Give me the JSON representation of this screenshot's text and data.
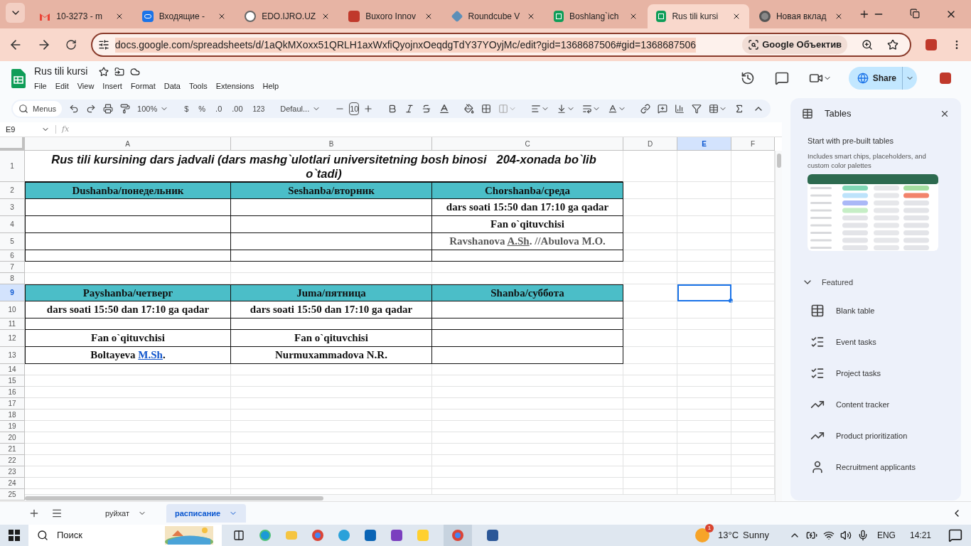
{
  "browser": {
    "tabs": [
      {
        "title": "10-3273 - m",
        "kind": "gmail",
        "selected": false
      },
      {
        "title": "Входящие -",
        "kind": "mail",
        "selected": false
      },
      {
        "title": "EDO.IJRO.UZ",
        "kind": "edo",
        "selected": false
      },
      {
        "title": "Buxoro Innov",
        "kind": "buxoro",
        "selected": false
      },
      {
        "title": "Roundcube V",
        "kind": "roundcube",
        "selected": false
      },
      {
        "title": "Boshlang`ich",
        "kind": "sheets",
        "selected": false
      },
      {
        "title": "Rus tili kursi",
        "kind": "sheets",
        "selected": true
      },
      {
        "title": "Новая вклад",
        "kind": "chrome",
        "selected": false
      }
    ],
    "url": "docs.google.com/spreadsheets/d/1aQkMXoxx51QRLH1axWxfiQyojnxOeqdgTdY37YOyjMc/edit?gid=1368687506#gid=1368687506",
    "lens_button": "Google Объектив"
  },
  "doc": {
    "title": "Rus tili kursi",
    "menu": [
      "File",
      "Edit",
      "View",
      "Insert",
      "Format",
      "Data",
      "Tools",
      "Extensions",
      "Help"
    ],
    "share": "Share"
  },
  "toolbar": {
    "search": "Menus",
    "zoom": "100%",
    "currency": "$",
    "percent": "%",
    "decrease_decimal": ".0",
    "increase_decimal": ".00",
    "number_format": "123",
    "font": "Defaul...",
    "font_size": "10"
  },
  "formula_bar": {
    "cell_ref": "E9",
    "fx": "fx"
  },
  "columns": [
    {
      "label": "A",
      "selected": false
    },
    {
      "label": "B",
      "selected": false
    },
    {
      "label": "C",
      "selected": false
    },
    {
      "label": "D",
      "selected": false
    },
    {
      "label": "E",
      "selected": true
    },
    {
      "label": "F",
      "selected": false
    }
  ],
  "rows": [
    {
      "number": "1",
      "kind": "title",
      "selected": false,
      "text": "Rus tili kursining dars jadvali (dars mashg`ulotlari universitetning bosh binosi   204-xonada bo`lib o`tadi)"
    },
    {
      "number": "2",
      "kind": "header",
      "selected": false,
      "cells": [
        {
          "text": "Dushanba/понедельник"
        },
        {
          "text": "Seshanba/вторник"
        },
        {
          "text": "Chorshanba/среда"
        }
      ]
    },
    {
      "number": "3",
      "kind": "table",
      "selected": false,
      "cells": [
        null,
        null,
        {
          "text": "dars soati 15:50 dan 17:10 ga qadar"
        }
      ]
    },
    {
      "number": "4",
      "kind": "table",
      "selected": false,
      "cells": [
        null,
        null,
        {
          "text": "Fan o`qituvchisi"
        }
      ]
    },
    {
      "number": "5",
      "kind": "table",
      "selected": false,
      "cells": [
        null,
        null,
        {
          "kind": "muted",
          "parts": [
            {
              "text": "Ravshanova "
            },
            {
              "text": "A.Sh",
              "kind": "underline"
            },
            {
              "text": ". //Abulova M.O."
            }
          ]
        }
      ]
    },
    {
      "number": "6",
      "kind": "table",
      "selected": false,
      "cells": [
        null,
        null,
        null
      ]
    },
    {
      "number": "7",
      "kind": "blank",
      "selected": false
    },
    {
      "number": "8",
      "kind": "blank",
      "selected": false
    },
    {
      "number": "9",
      "kind": "header",
      "selected": true,
      "cells": [
        {
          "text": "Payshanba/четверг"
        },
        {
          "text": "Juma/пятница"
        },
        {
          "text": "Shanba/суббота"
        }
      ]
    },
    {
      "number": "10",
      "kind": "table",
      "selected": false,
      "cells": [
        {
          "text": "dars soati 15:50 dan 17:10 ga qadar"
        },
        {
          "text": "dars soati 15:50 dan 17:10 ga qadar"
        },
        null
      ]
    },
    {
      "number": "11",
      "kind": "table",
      "selected": false,
      "cells": [
        null,
        null,
        null
      ]
    },
    {
      "number": "12",
      "kind": "table",
      "selected": false,
      "cells": [
        {
          "text": "Fan o`qituvchisi"
        },
        {
          "text": "Fan o`qituvchisi"
        },
        null
      ]
    },
    {
      "number": "13",
      "kind": "table",
      "selected": false,
      "cells": [
        {
          "parts": [
            {
              "text": "Boltayeva "
            },
            {
              "text": "M.Sh",
              "kind": "link"
            },
            {
              "text": "."
            }
          ]
        },
        {
          "text": "Nurmuxammadova N.R."
        },
        null
      ]
    },
    {
      "number": "14",
      "kind": "blank",
      "selected": false
    },
    {
      "number": "15",
      "kind": "blank",
      "selected": false
    },
    {
      "number": "16",
      "kind": "blank",
      "selected": false
    },
    {
      "number": "17",
      "kind": "blank",
      "selected": false
    },
    {
      "number": "18",
      "kind": "blank",
      "selected": false
    },
    {
      "number": "19",
      "kind": "blank",
      "selected": false
    },
    {
      "number": "20",
      "kind": "blank",
      "selected": false
    },
    {
      "number": "21",
      "kind": "blank",
      "selected": false
    },
    {
      "number": "22",
      "kind": "blank",
      "selected": false
    },
    {
      "number": "23",
      "kind": "blank",
      "selected": false
    },
    {
      "number": "24",
      "kind": "blank",
      "selected": false
    },
    {
      "number": "25",
      "kind": "blank",
      "selected": false
    }
  ],
  "sheets": [
    {
      "name": "руйхат",
      "selected": false
    },
    {
      "name": "расписание",
      "selected": true
    }
  ],
  "panel": {
    "title": "Tables",
    "heading": "Start with pre-built tables",
    "description": "Includes smart chips, placeholders, and custom color palettes",
    "section": "Featured",
    "expanded": true,
    "items": [
      {
        "label": "Blank table",
        "kind": "table"
      },
      {
        "label": "Event tasks",
        "kind": "tasks"
      },
      {
        "label": "Project tasks",
        "kind": "tasks"
      },
      {
        "label": "Content tracker",
        "kind": "trend"
      },
      {
        "label": "Product prioritization",
        "kind": "trend"
      },
      {
        "label": "Recruitment applicants",
        "kind": "person"
      }
    ]
  },
  "taskbar": {
    "search": "Поиск",
    "weather_badge": "1",
    "temperature": "13°C",
    "weather": "Sunny",
    "language": "ENG",
    "time": "14:21"
  }
}
